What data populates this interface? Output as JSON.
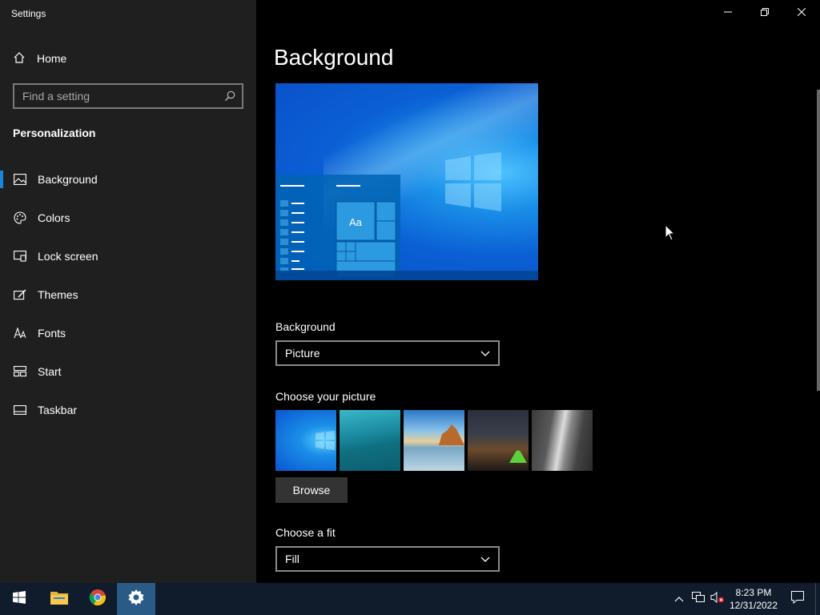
{
  "window": {
    "title": "Settings"
  },
  "sidebar": {
    "home_label": "Home",
    "search_placeholder": "Find a setting",
    "section_title": "Personalization",
    "items": [
      {
        "label": "Background",
        "icon": "picture-icon",
        "active": true
      },
      {
        "label": "Colors",
        "icon": "palette-icon"
      },
      {
        "label": "Lock screen",
        "icon": "lock-screen-icon"
      },
      {
        "label": "Themes",
        "icon": "themes-icon"
      },
      {
        "label": "Fonts",
        "icon": "fonts-icon"
      },
      {
        "label": "Start",
        "icon": "start-icon"
      },
      {
        "label": "Taskbar",
        "icon": "taskbar-icon"
      }
    ]
  },
  "main": {
    "title": "Background",
    "preview_sample_text": "Aa",
    "background_label": "Background",
    "background_value": "Picture",
    "choose_picture_label": "Choose your picture",
    "browse_label": "Browse",
    "fit_label": "Choose a fit",
    "fit_value": "Fill"
  },
  "taskbar": {
    "time": "8:23 PM",
    "date": "12/31/2022"
  },
  "colors": {
    "accent": "#1a86d9",
    "sidebar_bg": "#1f1f1f",
    "taskbar_bg": "#101c2c"
  }
}
